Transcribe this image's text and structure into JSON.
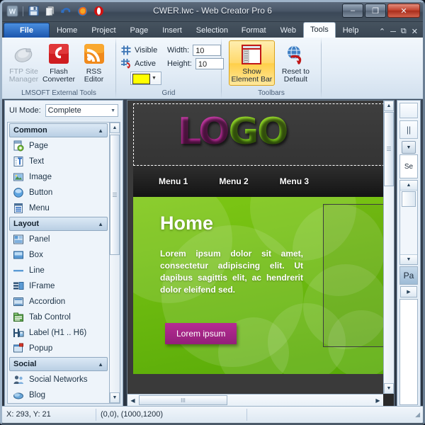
{
  "window": {
    "title": "CWER.lwc - Web Creator Pro 6",
    "quick_access": [
      {
        "name": "app-logo-icon",
        "glyph": "W"
      },
      {
        "name": "save-icon",
        "glyph": "save"
      },
      {
        "name": "copy-pages-icon",
        "glyph": "copy"
      },
      {
        "name": "undo-icon",
        "glyph": "undo"
      },
      {
        "name": "preview-firefox-icon",
        "glyph": "firefox"
      },
      {
        "name": "preview-opera-icon",
        "glyph": "opera"
      }
    ],
    "buttons": {
      "minimize": "–",
      "maximize": "❐",
      "close": "✕"
    }
  },
  "ribbon": {
    "tabs": [
      {
        "label": "File",
        "type": "file"
      },
      {
        "label": "Home",
        "type": "normal"
      },
      {
        "label": "Project",
        "type": "normal"
      },
      {
        "label": "Page",
        "type": "normal"
      },
      {
        "label": "Insert",
        "type": "normal"
      },
      {
        "label": "Selection",
        "type": "normal"
      },
      {
        "label": "Format",
        "type": "normal"
      },
      {
        "label": "Web",
        "type": "normal"
      },
      {
        "label": "Tools",
        "type": "active"
      },
      {
        "label": "Help",
        "type": "normal"
      }
    ],
    "window_controls": [
      "⌃",
      "─",
      "⧉",
      "✕"
    ],
    "groups": [
      {
        "label": "LMSOFT External Tools",
        "buttons": [
          {
            "name": "ftp-site-manager-button",
            "line1": "FTP Site",
            "line2": "Manager",
            "state": "disabled"
          },
          {
            "name": "flash-converter-button",
            "line1": "Flash",
            "line2": "Converter",
            "state": "normal"
          },
          {
            "name": "rss-editor-button",
            "line1": "RSS",
            "line2": "Editor",
            "state": "normal"
          }
        ]
      },
      {
        "label": "Grid",
        "visible_label": "Visible",
        "active_label": "Active",
        "width_label": "Width:",
        "width_value": "10",
        "height_label": "Height:",
        "height_value": "10",
        "grid_color": "#ffff00"
      },
      {
        "label": "Toolbars",
        "buttons": [
          {
            "name": "show-element-bar-button",
            "line1": "Show",
            "line2": "Element Bar",
            "state": "checked"
          },
          {
            "name": "reset-to-default-button",
            "line1": "Reset to",
            "line2": "Default",
            "state": "normal"
          }
        ]
      }
    ]
  },
  "sidebar": {
    "ui_mode_label": "UI Mode:",
    "ui_mode_value": "Complete",
    "sections": [
      {
        "title": "Common",
        "items": [
          {
            "label": "Page",
            "icon": "page-icon"
          },
          {
            "label": "Text",
            "icon": "text-icon"
          },
          {
            "label": "Image",
            "icon": "image-icon"
          },
          {
            "label": "Button",
            "icon": "button-icon"
          },
          {
            "label": "Menu",
            "icon": "menu-icon"
          }
        ]
      },
      {
        "title": "Layout",
        "items": [
          {
            "label": "Panel",
            "icon": "panel-icon"
          },
          {
            "label": "Box",
            "icon": "box-icon"
          },
          {
            "label": "Line",
            "icon": "line-icon"
          },
          {
            "label": "IFrame",
            "icon": "iframe-icon"
          },
          {
            "label": "Accordion",
            "icon": "accordion-icon"
          },
          {
            "label": "Tab Control",
            "icon": "tab-control-icon"
          },
          {
            "label": "Label (H1 .. H6)",
            "icon": "label-icon"
          },
          {
            "label": "Popup",
            "icon": "popup-icon"
          }
        ]
      },
      {
        "title": "Social",
        "items": [
          {
            "label": "Social Networks",
            "icon": "social-networks-icon"
          },
          {
            "label": "Blog",
            "icon": "blog-icon"
          }
        ]
      }
    ]
  },
  "canvas": {
    "logo": {
      "part1": "LO",
      "part2": "GO",
      "color1": "#bf35a0",
      "color2": "#7ec715"
    },
    "nav": [
      "Menu 1",
      "Menu 2",
      "Menu 3"
    ],
    "heading": "Home",
    "paragraph": "Lorem ipsum dolor sit amet, consectetur adipiscing elit. Ut dapibus sagittis elit, ac hendrerit dolor eleifend sed.",
    "cta_label": "Lorem ipsum",
    "cta_color": "#a3238e",
    "background_color": "#7ec715"
  },
  "right_dock": {
    "tabs": [
      {
        "label": "Se",
        "selected": false
      },
      {
        "label": "Pa",
        "selected": true
      }
    ]
  },
  "status_bar": {
    "coords": "X: 293, Y: 21",
    "page_size": "(0,0), (1000,1200)"
  }
}
